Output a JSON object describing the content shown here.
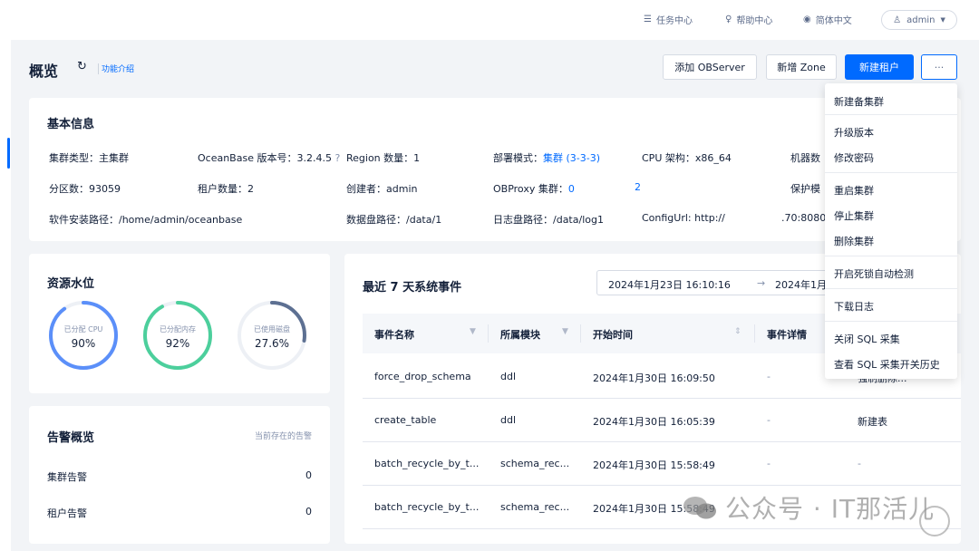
{
  "topbar": {
    "task_center": "任务中心",
    "help_center": "帮助中心",
    "language": "简体中文",
    "user": "admin"
  },
  "header": {
    "title": "概览",
    "intro_link": "功能介绍",
    "buttons": {
      "add_observer": "添加 OBServer",
      "add_zone": "新增 Zone",
      "new_tenant": "新建租户",
      "more": "···"
    }
  },
  "basic_info": {
    "title": "基本信息",
    "cluster_type": "集群类型：主集群",
    "version": "OceanBase 版本号：3.2.4.5",
    "region_count": "Region 数量：1",
    "deploy_mode_label": "部署模式：",
    "deploy_mode_value": "集群 (3-3-3)",
    "cpu_arch": "CPU 架构：x86_64",
    "machine": "机器数",
    "partition_count": "分区数：93059",
    "tenant_count": "租户数量：2",
    "creator": "创建者：admin",
    "obproxy_label": "OBProxy 集群：",
    "obproxy_value": "0",
    "obproxy_extra": "2",
    "protect": "保护模",
    "install_path": "软件安装路径：/home/admin/oceanbase",
    "data_path": "数据盘路径：/data/1",
    "log_path": "日志盘路径：/data/log1",
    "config_url": "ConfigUrl: http://",
    "config_url_tail": ".70:8080/"
  },
  "resource": {
    "title": "资源水位",
    "rings": [
      {
        "label": "已分配 CPU",
        "value": "90%",
        "percent": 90,
        "color": "#5b8ff9"
      },
      {
        "label": "已分配内存",
        "value": "92%",
        "percent": 92,
        "color": "#4ccf9c"
      },
      {
        "label": "已使用磁盘",
        "value": "27.6%",
        "percent": 27.6,
        "color": "#5d7092"
      }
    ]
  },
  "alarms": {
    "title": "告警概览",
    "subtitle": "当前存在的告警",
    "cluster_label": "集群告警",
    "cluster_value": "0",
    "tenant_label": "租户告警",
    "tenant_value": "0"
  },
  "events": {
    "title": "最近 7 天系统事件",
    "date_start": "2024年1月23日 16:10:16",
    "date_sep": "→",
    "date_end": "2024年1月",
    "columns": {
      "name": "事件名称",
      "module": "所属模块",
      "start_time": "开始时间",
      "detail": "事件详情"
    },
    "rows": [
      {
        "name": "force_drop_schema",
        "module": "ddl",
        "time": "2024年1月30日 16:09:50",
        "detail": "-",
        "desc": "强制删除..."
      },
      {
        "name": "create_table",
        "module": "ddl",
        "time": "2024年1月30日 16:05:39",
        "detail": "-",
        "desc": "新建表"
      },
      {
        "name": "batch_recycle_by_t...",
        "module": "schema_rec...",
        "time": "2024年1月30日 15:58:49",
        "detail": "-",
        "desc": "-"
      },
      {
        "name": "batch_recycle_by_t...",
        "module": "schema_rec...",
        "time": "2024年1月30日 15:58:49",
        "detail": "",
        "desc": ""
      }
    ]
  },
  "dropdown": {
    "items": [
      "新建备集群",
      "升级版本",
      "修改密码",
      "重启集群",
      "停止集群",
      "删除集群",
      "开启死锁自动检测",
      "下载日志",
      "关闭 SQL 采集",
      "查看 SQL 采集开关历史"
    ]
  },
  "watermark": "公众号 · IT那活儿"
}
